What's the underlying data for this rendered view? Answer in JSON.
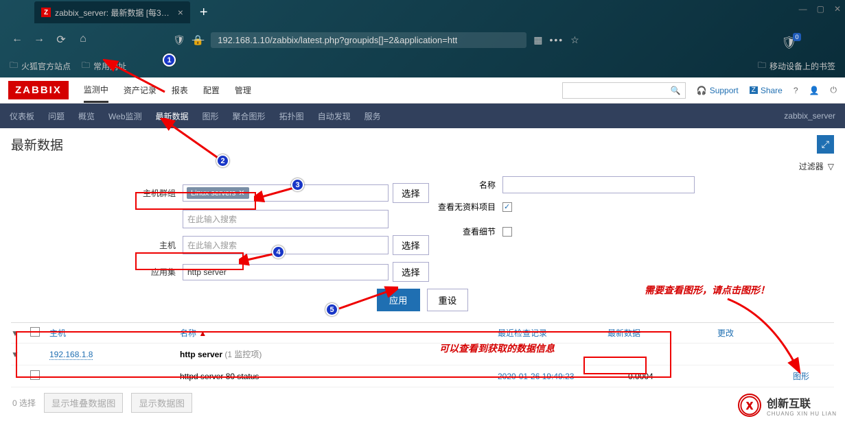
{
  "browser": {
    "tab_title": "zabbix_server: 最新数据 [每3…",
    "url": "192.168.1.10/zabbix/latest.php?groupids[]=2&application=htt",
    "bookmarks": {
      "ff_official": "火狐官方站点",
      "common": "常用网址",
      "mobile_bm": "移动设备上的书签"
    }
  },
  "header": {
    "logo": "ZABBIX",
    "menu": {
      "monitoring": "监测中",
      "inventory": "资产记录",
      "reports": "报表",
      "config": "配置",
      "admin": "管理"
    },
    "support": "Support",
    "share": "Share"
  },
  "subnav": {
    "dashboard": "仪表板",
    "problems": "问题",
    "overview": "概览",
    "web": "Web监测",
    "latest": "最新数据",
    "graphs": "图形",
    "screens": "聚合图形",
    "maps": "拓扑图",
    "discovery": "自动发现",
    "services": "服务",
    "right": "zabbix_server"
  },
  "page": {
    "title": "最新数据",
    "filter_label": "过滤器"
  },
  "filter": {
    "hostgroup_label": "主机群组",
    "hostgroup_tag": "Linux servers",
    "hostgroup_ph": "在此输入搜索",
    "host_label": "主机",
    "host_ph": "在此输入搜索",
    "app_label": "应用集",
    "app_value": "http server",
    "select_btn": "选择",
    "name_label": "名称",
    "show_nodata_label": "查看无资料项目",
    "show_details_label": "查看细节",
    "apply": "应用",
    "reset": "重设"
  },
  "table": {
    "col_host": "主机",
    "col_name": "名称",
    "col_last": "最近检查记录",
    "col_latest": "最新数据",
    "col_change": "更改",
    "group_host": "192.168.1.8",
    "group_app": "http server",
    "group_items": "(1 监控项)",
    "item_name": "httpd server 80 status",
    "item_time": "2020-01-26 19:49:23",
    "item_value": "0.0004",
    "action": "图形"
  },
  "footer": {
    "selected": "0 选择",
    "stacked": "显示堆叠数据图",
    "graph": "显示数据图"
  },
  "annot": {
    "msg1": "可以查看到获取的数据信息",
    "msg2": "需要查看图形，请点击图形！"
  },
  "watermark": {
    "cn": "创新互联",
    "py": "CHUANG XIN HU LIAN"
  }
}
